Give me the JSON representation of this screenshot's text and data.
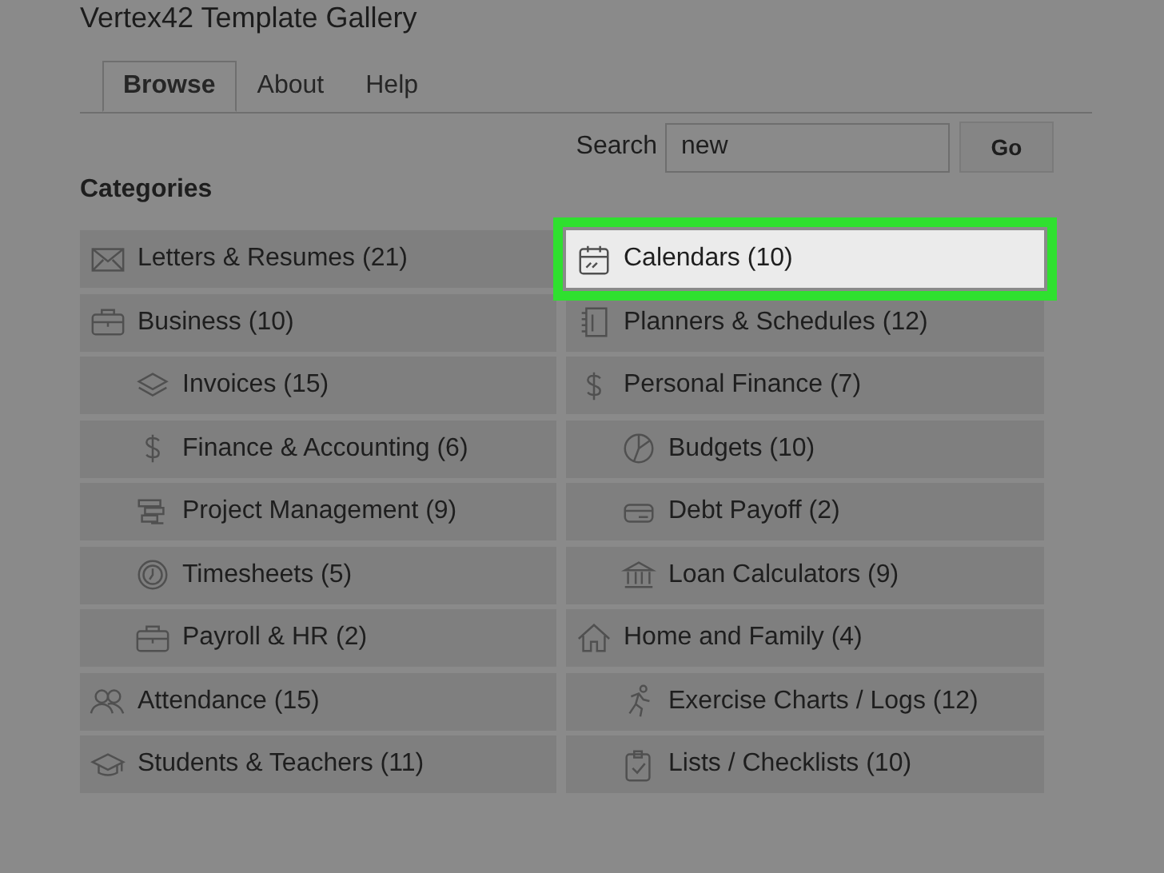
{
  "title": "Vertex42 Template Gallery",
  "tabs": [
    {
      "label": "Browse",
      "selected": true
    },
    {
      "label": "About",
      "selected": false
    },
    {
      "label": "Help",
      "selected": false
    }
  ],
  "search": {
    "label": "Search",
    "value": "new",
    "button": "Go"
  },
  "categories_heading": "Categories",
  "columns": [
    [
      {
        "label": "Letters & Resumes (21)",
        "selected": false
      },
      {
        "label": "Business (10)",
        "selected": false,
        "children": [
          {
            "label": "Invoices (15)",
            "selected": false
          },
          {
            "label": "Finance & Accounting (6)",
            "selected": false
          },
          {
            "label": "Project Management (9)",
            "selected": false
          },
          {
            "label": "Timesheets (5)",
            "selected": false
          },
          {
            "label": "Payroll & HR (2)",
            "selected": false
          }
        ]
      },
      {
        "label": "Attendance (15)",
        "selected": false
      },
      {
        "label": "Students & Teachers (11)",
        "selected": false
      }
    ],
    [
      {
        "label": "Calendars (10)",
        "selected": true
      },
      {
        "label": "Planners & Schedules (12)",
        "selected": false
      },
      {
        "label": "Personal Finance (7)",
        "selected": false,
        "children": [
          {
            "label": "Budgets (10)",
            "selected": false
          },
          {
            "label": "Debt Payoff (2)",
            "selected": false
          },
          {
            "label": "Loan Calculators (9)",
            "selected": false
          }
        ]
      },
      {
        "label": "Home and Family (4)",
        "selected": false,
        "children": [
          {
            "label": "Exercise Charts / Logs (12)",
            "selected": false
          },
          {
            "label": "Lists / Checklists (10)",
            "selected": false
          }
        ]
      }
    ]
  ]
}
